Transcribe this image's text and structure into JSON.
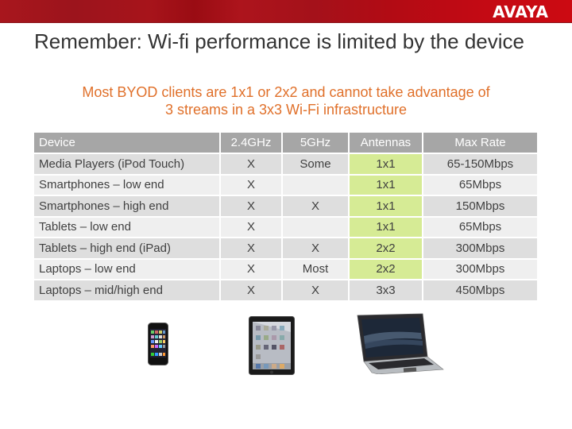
{
  "header": {
    "brand": "AVAYA",
    "brand_color": "#c8102e"
  },
  "slide": {
    "title": "Remember: Wi-fi performance is limited by the device",
    "subtitle": "Most BYOD clients are 1x1 or 2x2 and cannot take advantage of 3 streams in a 3x3 Wi-Fi infrastructure",
    "subtitle_color": "#e0702a"
  },
  "table": {
    "columns": [
      "Device",
      "2.4GHz",
      "5GHz",
      "Antennas",
      "Max Rate"
    ],
    "highlight_color": "#d6eb95",
    "rows": [
      {
        "device": "Media Players (iPod Touch)",
        "ghz24": "X",
        "ghz5": "Some",
        "antennas": "1x1",
        "max_rate": "65-150Mbps",
        "highlight": true
      },
      {
        "device": "Smartphones – low end",
        "ghz24": "X",
        "ghz5": "",
        "antennas": "1x1",
        "max_rate": "65Mbps",
        "highlight": true
      },
      {
        "device": "Smartphones – high end",
        "ghz24": "X",
        "ghz5": "X",
        "antennas": "1x1",
        "max_rate": "150Mbps",
        "highlight": true
      },
      {
        "device": "Tablets – low end",
        "ghz24": "X",
        "ghz5": "",
        "antennas": "1x1",
        "max_rate": "65Mbps",
        "highlight": true
      },
      {
        "device": "Tablets – high end (iPad)",
        "ghz24": "X",
        "ghz5": "X",
        "antennas": "2x2",
        "max_rate": "300Mbps",
        "highlight": true
      },
      {
        "device": "Laptops – low end",
        "ghz24": "X",
        "ghz5": "Most",
        "antennas": "2x2",
        "max_rate": "300Mbps",
        "highlight": true
      },
      {
        "device": "Laptops – mid/high end",
        "ghz24": "X",
        "ghz5": "X",
        "antennas": "3x3",
        "max_rate": "450Mbps",
        "highlight": false
      }
    ]
  },
  "images": [
    {
      "name": "ipod-touch-image",
      "label": "iPod Touch"
    },
    {
      "name": "ipad-image",
      "label": "iPad"
    },
    {
      "name": "laptop-image",
      "label": "Laptop"
    }
  ]
}
